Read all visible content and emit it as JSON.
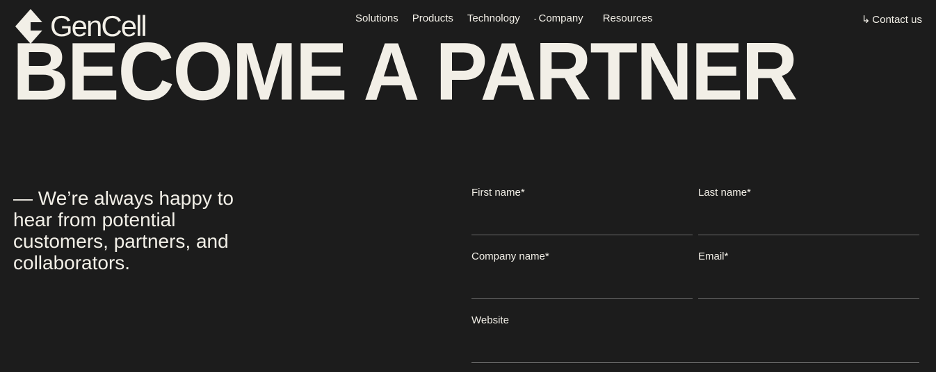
{
  "brand": {
    "name": "GenCell",
    "logo_icon": "gencell-diamond-icon"
  },
  "nav": {
    "items": [
      {
        "label": "Solutions"
      },
      {
        "label": "Products"
      },
      {
        "label": "Technology"
      },
      {
        "label": "Company",
        "marker": "-"
      },
      {
        "label": "Resources"
      }
    ]
  },
  "contact": {
    "arrow": "↳",
    "label": "Contact us"
  },
  "hero": {
    "title": "BECOME A PARTNER"
  },
  "intro": {
    "text": "— We’re always happy to hear from potential customers, partners, and collaborators."
  },
  "form": {
    "first_name": {
      "label": "First name*",
      "value": ""
    },
    "last_name": {
      "label": "Last name*",
      "value": ""
    },
    "company_name": {
      "label": "Company name*",
      "value": ""
    },
    "email": {
      "label": "Email*",
      "value": ""
    },
    "website": {
      "label": "Website",
      "value": ""
    }
  },
  "colors": {
    "background": "#1c1c1c",
    "text": "#f2efe7",
    "divider": "#6b6b6b"
  }
}
